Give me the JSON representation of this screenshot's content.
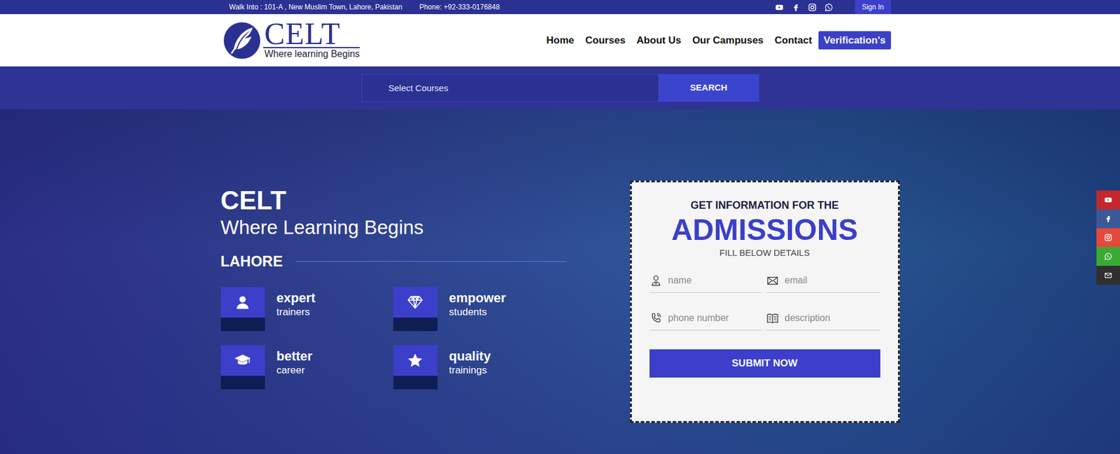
{
  "topbar": {
    "address": "Walk Into : 101-A , New Muslim Town, Lahore, Pakistan",
    "phone": "Phone: +92-333-0176848",
    "sign_in": "Sign In"
  },
  "logo": {
    "name": "CELT",
    "tagline": "Where learning Begins"
  },
  "nav": {
    "items": [
      "Home",
      "Courses",
      "About Us",
      "Our Campuses",
      "Contact"
    ],
    "cta": "Verification's"
  },
  "search": {
    "placeholder": "Select Courses",
    "button": "SEARCH"
  },
  "hero": {
    "title": "CELT",
    "subtitle": "Where Learning Begins",
    "city": "LAHORE",
    "features": [
      {
        "title": "expert",
        "text": "trainers",
        "kind": "person"
      },
      {
        "title": "empower",
        "text": "students",
        "kind": "diamond"
      },
      {
        "title": "better",
        "text": "career",
        "kind": "cap"
      },
      {
        "title": "quality",
        "text": "trainings",
        "kind": "star"
      }
    ]
  },
  "form": {
    "eyebrow": "GET INFORMATION FOR THE",
    "title": "ADMISSIONS",
    "subtitle": "FILL BELOW DETAILS",
    "fields": [
      {
        "placeholder": "name",
        "kind": "user"
      },
      {
        "placeholder": "email",
        "kind": "mail"
      },
      {
        "placeholder": "phone number",
        "kind": "phone"
      },
      {
        "placeholder": "description",
        "kind": "book"
      }
    ],
    "submit": "SUBMIT NOW"
  },
  "side_social": [
    {
      "kind": "youtube",
      "color": "#c4282d"
    },
    {
      "kind": "facebook",
      "color": "#3b5998"
    },
    {
      "kind": "instagram",
      "color": "#e5493a"
    },
    {
      "kind": "whatsapp",
      "color": "#3aaa35"
    },
    {
      "kind": "envelope",
      "color": "#2f2f2f"
    }
  ]
}
